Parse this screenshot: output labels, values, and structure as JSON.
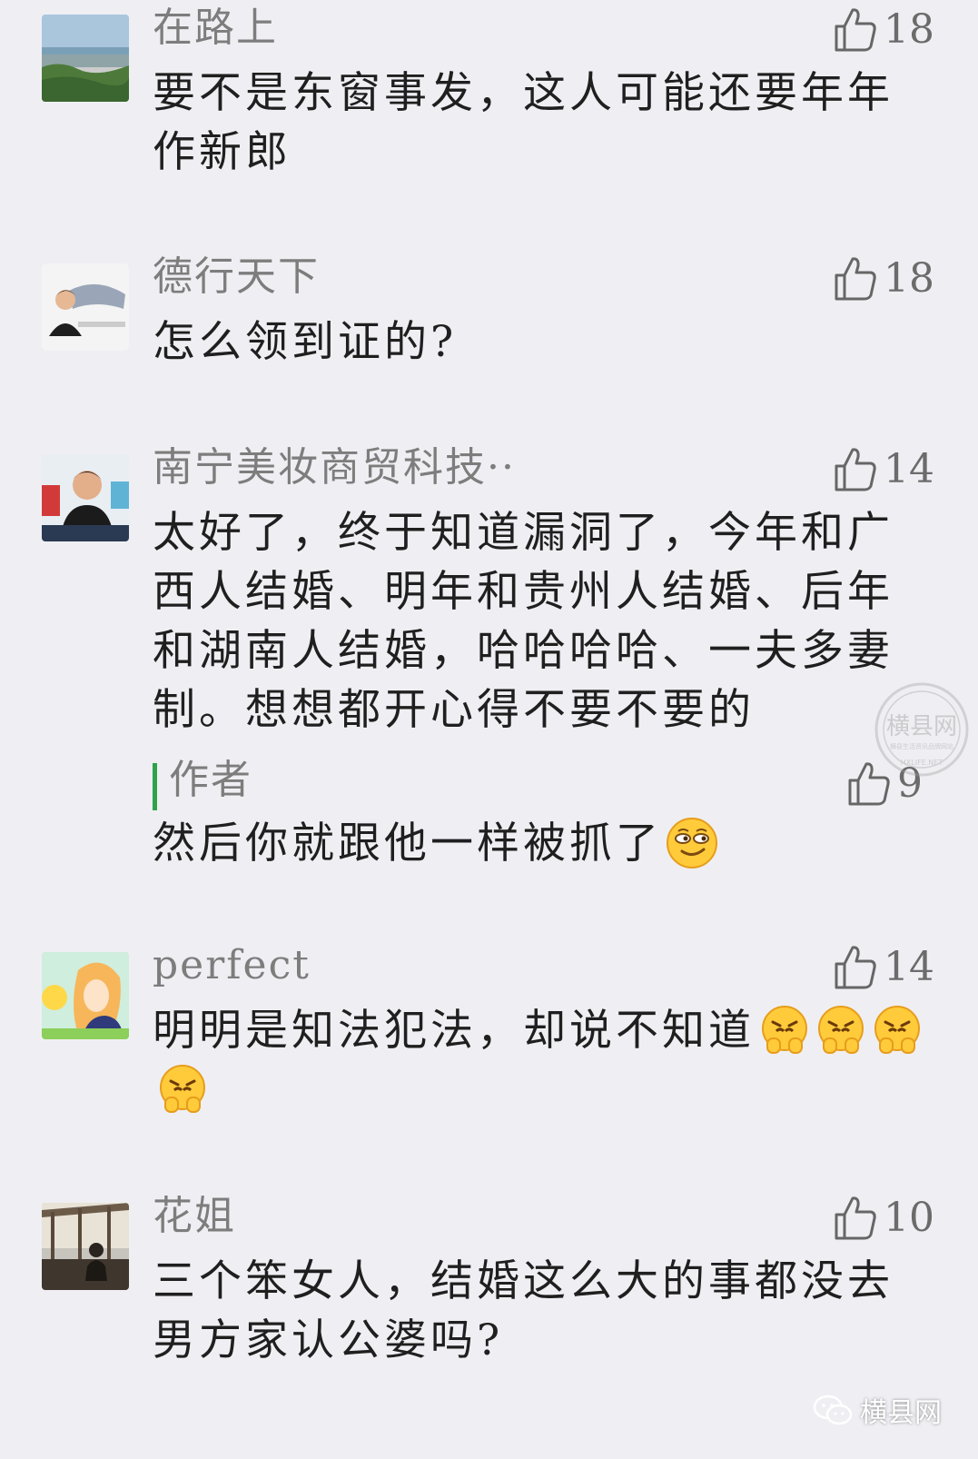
{
  "comments": [
    {
      "name": "在路上",
      "likes": "18",
      "text": "要不是东窗事发，这人可能还要年年作新郎"
    },
    {
      "name": "德行天下",
      "likes": "18",
      "text": "怎么领到证的?"
    },
    {
      "name": "南宁美妆商贸科技··",
      "likes": "14",
      "text": "太好了，终于知道漏洞了，今年和广西人结婚、明年和贵州人结婚、后年和湖南人结婚，哈哈哈哈、一夫多妻制。想想都开心得不要不要的",
      "reply": {
        "author": "作者",
        "likes": "9",
        "text": "然后你就跟他一样被抓了",
        "emoji": "smirk-emoji"
      }
    },
    {
      "name": "perfect",
      "likes": "14",
      "text": "明明是知法犯法，却说不知道",
      "emoji": "angry-hands-emoji",
      "emoji_count": 4
    },
    {
      "name": "花姐",
      "likes": "10",
      "text": "三个笨女人，结婚这么大的事都没去男方家认公婆吗?"
    }
  ],
  "watermark": {
    "brand": "横县网",
    "stamp_title": "横县网",
    "stamp_subtitle": "横县生活资讯品牌网站",
    "stamp_url": "HXLIFE.NET"
  },
  "colors": {
    "background": "#efeff3",
    "name": "#7d7d7d",
    "text": "#1f1f1f",
    "author_bar": "#2ea34a"
  }
}
